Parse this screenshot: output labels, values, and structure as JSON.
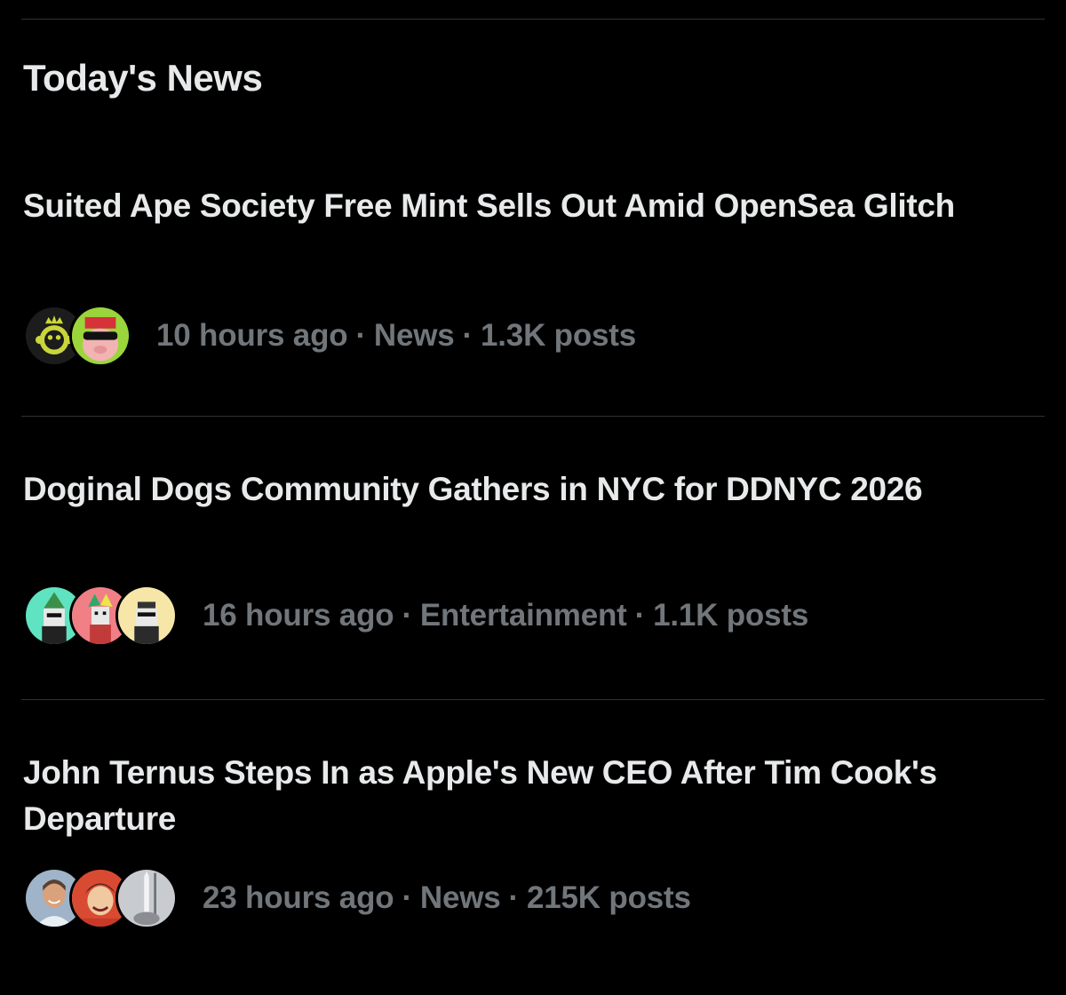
{
  "section": {
    "title": "Today's News"
  },
  "items": [
    {
      "headline": "Suited Ape Society Free Mint Sells Out Amid OpenSea Glitch",
      "time": "10 hours ago",
      "category": "News",
      "posts": "1.3K posts",
      "separator": "·",
      "avatars": [
        "ape-crown-avatar",
        "pig-sunglasses-avatar"
      ]
    },
    {
      "headline": "Doginal Dogs Community Gathers in NYC for DDNYC 2026",
      "time": "16 hours ago",
      "category": "Entertainment",
      "posts": "1.1K posts",
      "separator": "·",
      "avatars": [
        "pixel-dog-wizard-avatar",
        "pixel-dog-jester-avatar",
        "pixel-dog-sunglasses-avatar"
      ]
    },
    {
      "headline": "John Ternus Steps In as Apple's New CEO After Tim Cook's Departure",
      "time": "23 hours ago",
      "category": "News",
      "posts": "215K posts",
      "separator": "·",
      "avatars": [
        "man-portrait-avatar",
        "anime-character-avatar",
        "rocket-launch-avatar"
      ]
    }
  ],
  "colors": {
    "background": "#000000",
    "text_primary": "#e7e9ea",
    "text_secondary": "#71767b",
    "divider": "#2f3336"
  }
}
